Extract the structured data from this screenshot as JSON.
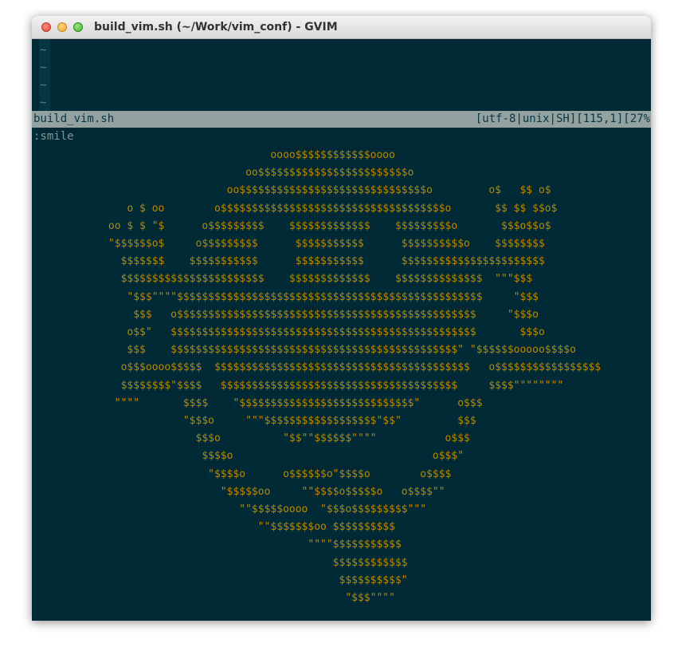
{
  "window": {
    "title": "build_vim.sh (~/Work/vim_conf) - GVIM"
  },
  "buffer": {
    "tildes": [
      "~",
      "~",
      "~",
      "~"
    ]
  },
  "statusline": {
    "filename": "build_vim.sh",
    "info": "[utf-8|unix|SH][115,1][27%"
  },
  "command": ":smile",
  "art": "                                      oooo$$$$$$$$$$$$oooo\n                                  oo$$$$$$$$$$$$$$$$$$$$$$$$o\n                               oo$$$$$$$$$$$$$$$$$$$$$$$$$$$$$$o         o$   $$ o$\n               o $ oo        o$$$$$$$$$$$$$$$$$$$$$$$$$$$$$$$$$$$$o       $$ $$ $$o$\n            oo $ $ \"$      o$$$$$$$$$    $$$$$$$$$$$$$    $$$$$$$$$o       $$$o$$o$\n            \"$$$$$$o$     o$$$$$$$$$      $$$$$$$$$$$      $$$$$$$$$$o    $$$$$$$$\n              $$$$$$$    $$$$$$$$$$$      $$$$$$$$$$$      $$$$$$$$$$$$$$$$$$$$$$$\n              $$$$$$$$$$$$$$$$$$$$$$$    $$$$$$$$$$$$$    $$$$$$$$$$$$$$  \"\"\"$$$\n               \"$$$\"\"\"\"$$$$$$$$$$$$$$$$$$$$$$$$$$$$$$$$$$$$$$$$$$$$$$$$$     \"$$$\n                $$$   o$$$$$$$$$$$$$$$$$$$$$$$$$$$$$$$$$$$$$$$$$$$$$$$$     \"$$$o\n               o$$\"   $$$$$$$$$$$$$$$$$$$$$$$$$$$$$$$$$$$$$$$$$$$$$$$$$       $$$o\n               $$$    $$$$$$$$$$$$$$$$$$$$$$$$$$$$$$$$$$$$$$$$$$$$$$\" \"$$$$$$ooooo$$$$o\n              o$$$oooo$$$$$  $$$$$$$$$$$$$$$$$$$$$$$$$$$$$$$$$$$$$$$$$   o$$$$$$$$$$$$$$$$$\n              $$$$$$$$\"$$$$   $$$$$$$$$$$$$$$$$$$$$$$$$$$$$$$$$$$$$$     $$$$\"\"\"\"\"\"\"\"\n             \"\"\"\"       $$$$    \"$$$$$$$$$$$$$$$$$$$$$$$$$$$$\"      o$$$\n                        \"$$$o     \"\"\"$$$$$$$$$$$$$$$$$$\"$$\"         $$$\n                          $$$o          \"$$\"\"$$$$$$\"\"\"\"           o$$$\n                           $$$$o                                o$$$\"\n                            \"$$$$o      o$$$$$$o\"$$$$o        o$$$$\n                              \"$$$$$oo     \"\"$$$$o$$$$$o   o$$$$\"\"\n                                 \"\"$$$$$oooo  \"$$$o$$$$$$$$$\"\"\"\n                                    \"\"$$$$$$$oo $$$$$$$$$$\n                                            \"\"\"\"$$$$$$$$$$$\n                                                $$$$$$$$$$$$\n                                                 $$$$$$$$$$\"\n                                                  \"$$$\"\"\"\""
}
